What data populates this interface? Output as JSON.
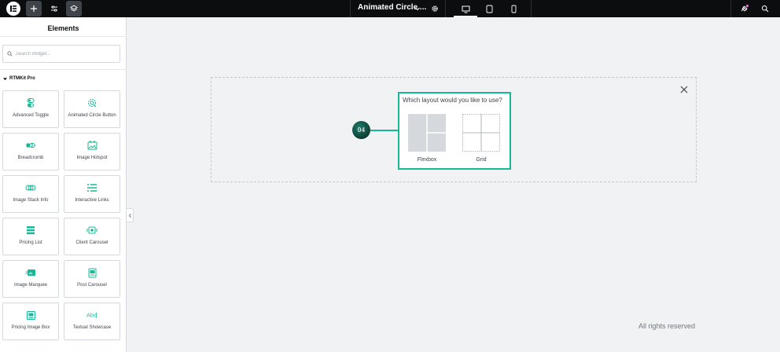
{
  "topbar": {
    "doc_title": "Animated Circle ...",
    "icons": [
      "elementor-logo-icon",
      "add-icon",
      "settings-sliders-icon",
      "layers-icon",
      "chevron-down-icon",
      "gear-icon",
      "desktop-icon",
      "tablet-icon",
      "mobile-icon",
      "notifications-icon",
      "search-icon"
    ]
  },
  "sidebar": {
    "title": "Elements",
    "search_placeholder": "Search Widget...",
    "category": "RTMKit Pro",
    "widgets": [
      {
        "label": "Advanced Toggle",
        "icon": "toggle-icon"
      },
      {
        "label": "Animated Circle Button",
        "icon": "circle-button-icon"
      },
      {
        "label": "Breadcrumb",
        "icon": "breadcrumb-icon"
      },
      {
        "label": "Image Hotspot",
        "icon": "image-hotspot-icon"
      },
      {
        "label": "Image Stack Info",
        "icon": "image-stack-icon"
      },
      {
        "label": "Interactive Links",
        "icon": "interactive-links-icon"
      },
      {
        "label": "Pricing List",
        "icon": "pricing-list-icon"
      },
      {
        "label": "Client Carousel",
        "icon": "client-carousel-icon"
      },
      {
        "label": "Image Marquee",
        "icon": "image-marquee-icon"
      },
      {
        "label": "Post Carousel",
        "icon": "post-carousel-icon"
      },
      {
        "label": "Pricing Image Box",
        "icon": "pricing-image-box-icon"
      },
      {
        "label": "Textual Showcase",
        "icon": "textual-showcase-icon"
      }
    ]
  },
  "canvas": {
    "step_number": "04",
    "layout_question": "Which layout would you like to use?",
    "options": [
      {
        "label": "Flexbox"
      },
      {
        "label": "Grid"
      }
    ],
    "footer": "All rights reserved"
  },
  "colors": {
    "accent": "#16b896",
    "topbar_bg": "#0c0d0e",
    "canvas_bg": "#f1f2f4"
  }
}
